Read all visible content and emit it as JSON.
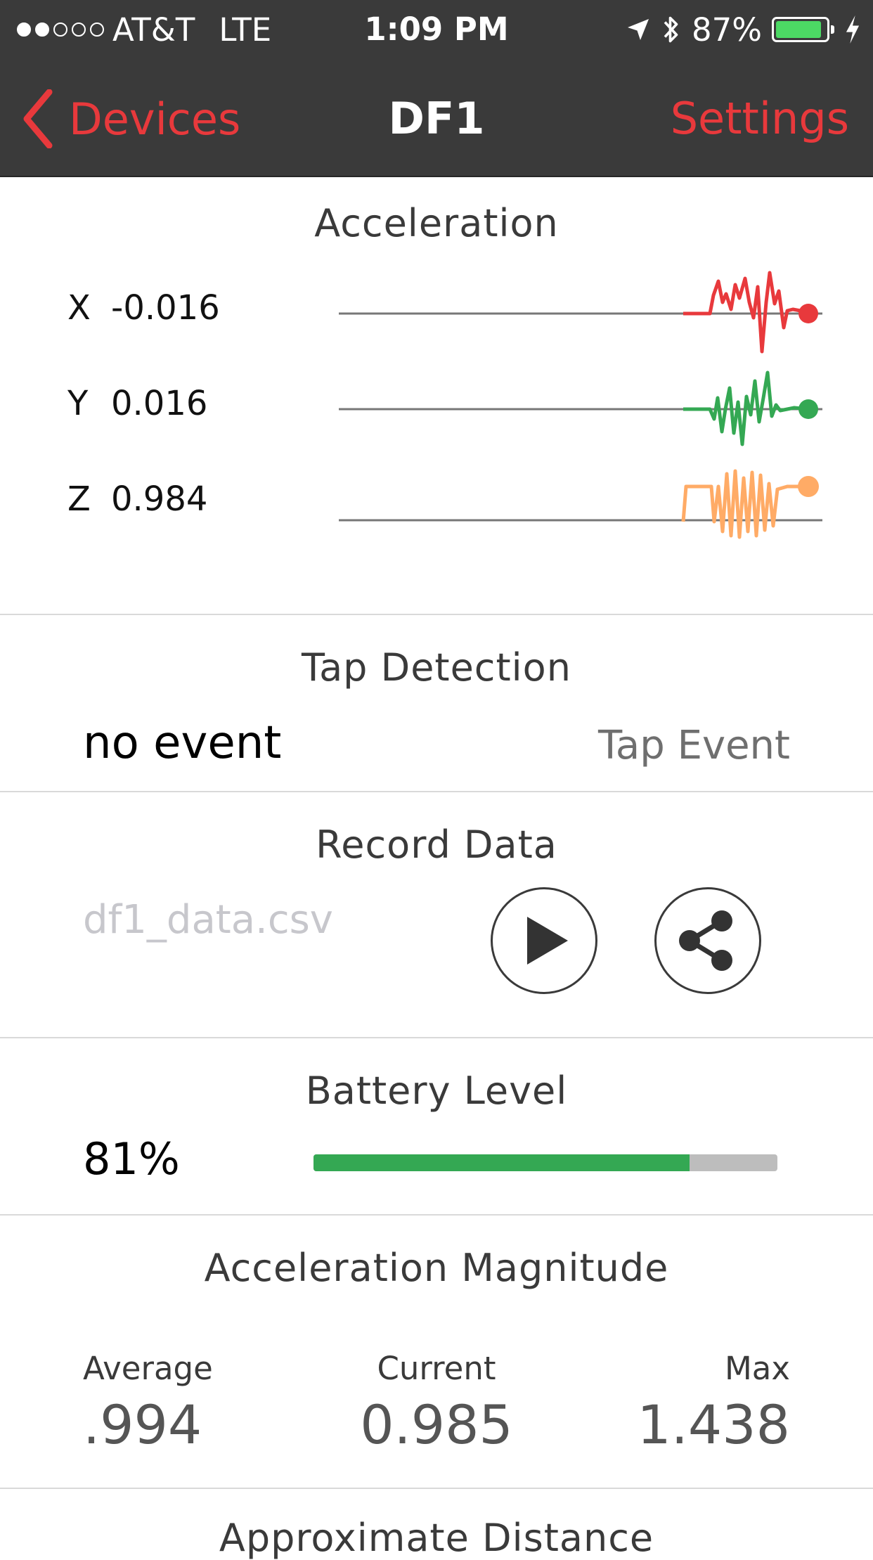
{
  "status_bar": {
    "signal_dots_filled": 2,
    "signal_dots_total": 5,
    "carrier": "AT&T",
    "network": "LTE",
    "time": "1:09 PM",
    "battery_percent": "87%",
    "battery_level": 0.87,
    "icons": [
      "location-arrow-icon",
      "bluetooth-icon",
      "battery-icon",
      "charging-bolt-icon"
    ]
  },
  "nav": {
    "back_label": "Devices",
    "title": "DF1",
    "settings_label": "Settings",
    "accent_color": "#e8393c"
  },
  "acceleration": {
    "title": "Acceleration",
    "axes": [
      {
        "axis": "X",
        "value": "-0.016",
        "color": "#e8393c"
      },
      {
        "axis": "Y",
        "value": "0.016",
        "color": "#34a853"
      },
      {
        "axis": "Z",
        "value": "0.984",
        "color": "#ffab66"
      }
    ]
  },
  "tap": {
    "title": "Tap Detection",
    "value": "no event",
    "event_label": "Tap Event"
  },
  "record": {
    "title": "Record Data",
    "filename_placeholder": "df1_data.csv",
    "icons": [
      "play-icon",
      "share-icon"
    ]
  },
  "battery": {
    "title": "Battery Level",
    "value": "81%",
    "level": 0.81,
    "fill_color": "#34a853"
  },
  "magnitude": {
    "title": "Acceleration Magnitude",
    "average_label": "Average",
    "average_value": ".994",
    "current_label": "Current",
    "current_value": "0.985",
    "max_label": "Max",
    "max_value": "1.438"
  },
  "distance": {
    "title": "Approximate Distance"
  }
}
